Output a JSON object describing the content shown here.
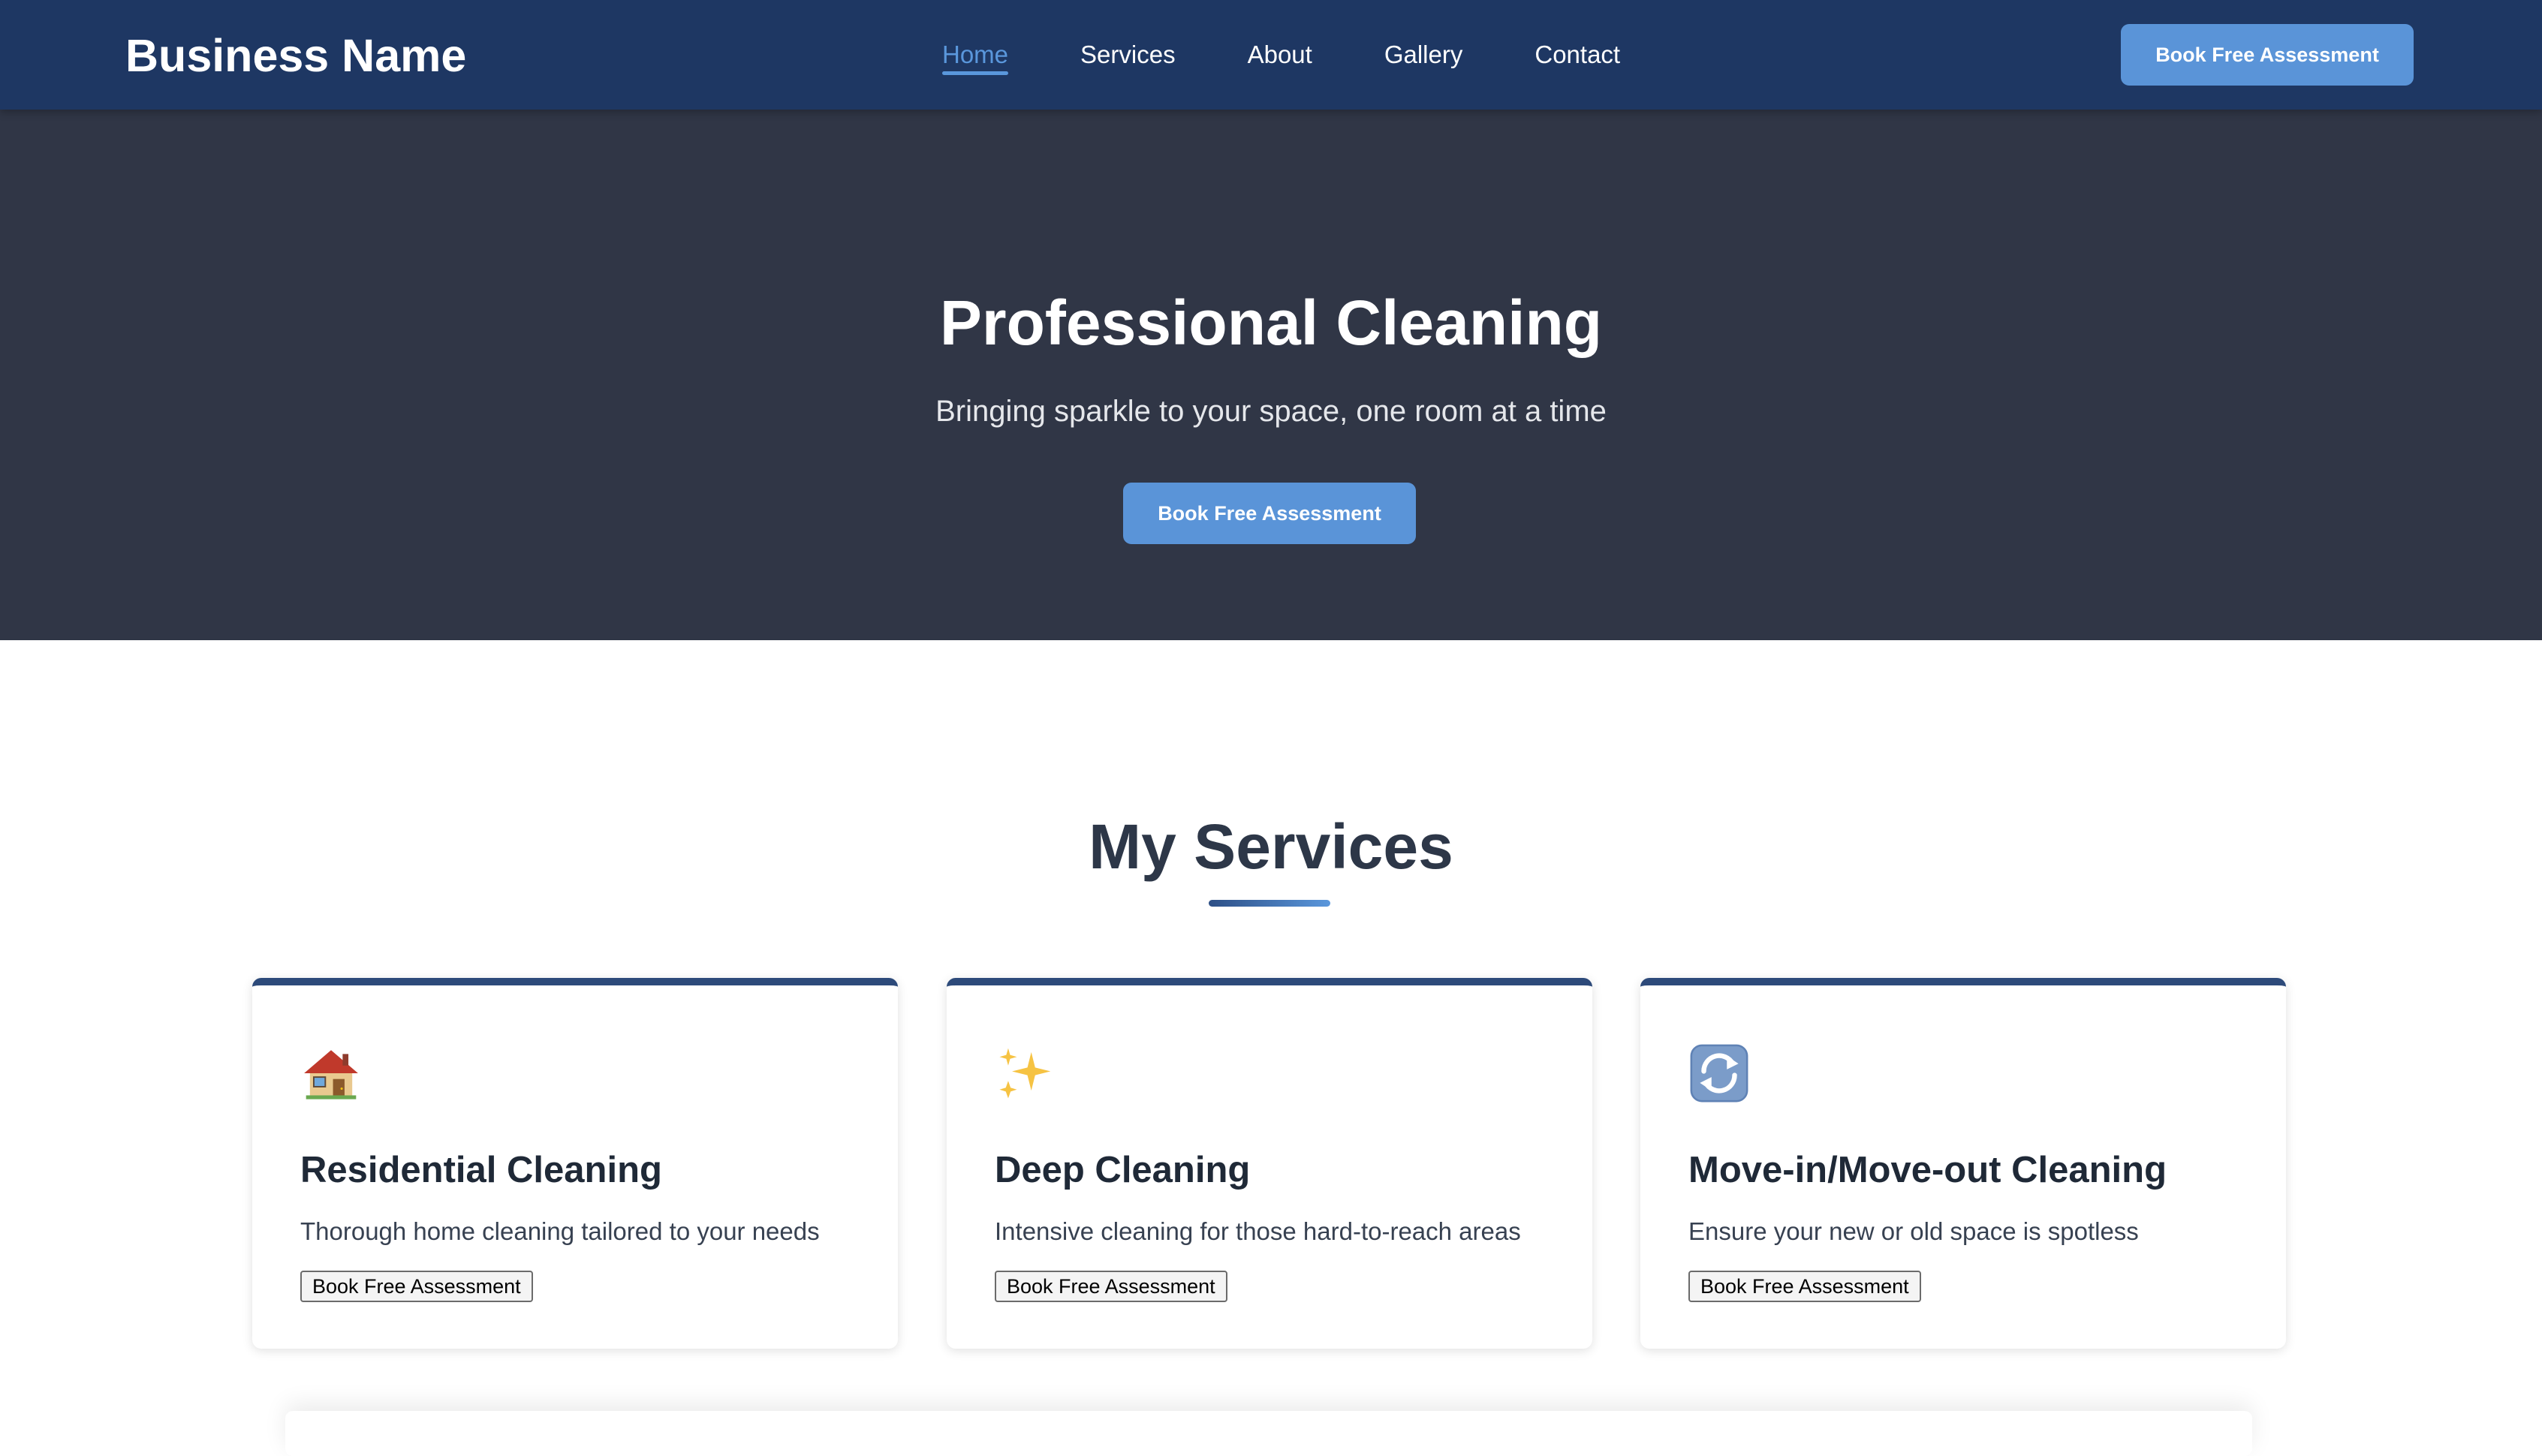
{
  "navbar": {
    "brand": "Business Name",
    "links": [
      {
        "label": "Home",
        "active": true
      },
      {
        "label": "Services",
        "active": false
      },
      {
        "label": "About",
        "active": false
      },
      {
        "label": "Gallery",
        "active": false
      },
      {
        "label": "Contact",
        "active": false
      }
    ],
    "cta_label": "Book Free Assessment"
  },
  "hero": {
    "title": "Professional Cleaning",
    "subtitle": "Bringing sparkle to your space, one room at a time",
    "cta_label": "Book Free Assessment"
  },
  "services": {
    "title": "My Services",
    "cards": [
      {
        "icon": "house-icon",
        "title": "Residential Cleaning",
        "description": "Thorough home cleaning tailored to your needs",
        "button_label": "Book Free Assessment"
      },
      {
        "icon": "sparkles-icon",
        "title": "Deep Cleaning",
        "description": "Intensive cleaning for those hard-to-reach areas",
        "button_label": "Book Free Assessment"
      },
      {
        "icon": "refresh-icon",
        "title": "Move-in/Move-out Cleaning",
        "description": "Ensure your new or old space is spotless",
        "button_label": "Book Free Assessment"
      }
    ]
  },
  "colors": {
    "navbar_bg": "#1e3763",
    "hero_bg": "#303646",
    "accent": "#5a94d8",
    "card_top_border": "#2d4a7a",
    "heading_text": "#2d3748"
  }
}
